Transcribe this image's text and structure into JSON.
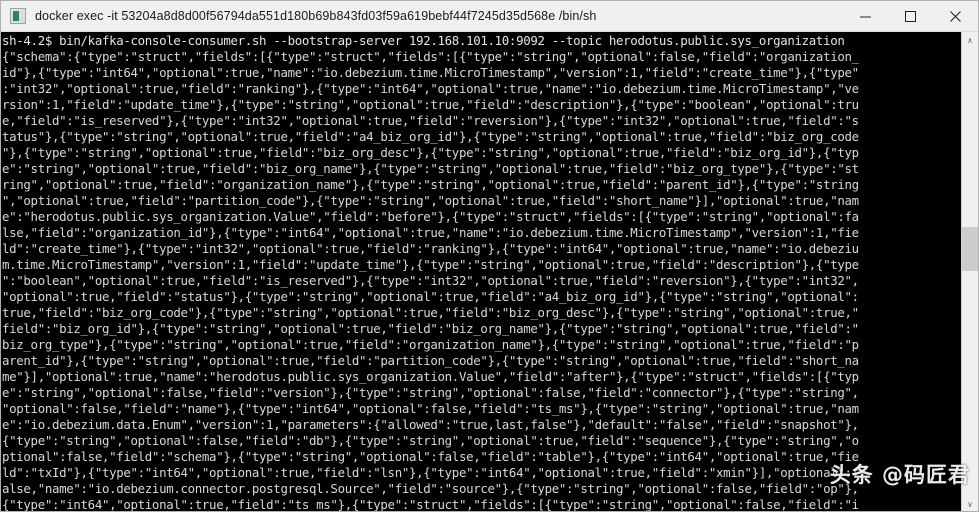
{
  "window": {
    "title": "docker  exec -it 53204a8d8d00f56794da551d180b69b843fd03f59a619bebf44f7245d35d568e /bin/sh",
    "icon": "terminal-icon",
    "minimize_label": "─",
    "maximize_label": "☐",
    "close_label": "✕"
  },
  "scrollbar": {
    "up_arrow": "∧",
    "down_arrow": "∨"
  },
  "watermark": {
    "text": "头条 @码匠君"
  },
  "terminal": {
    "prompt": "sh-4.2$",
    "command": "bin/kafka-console-consumer.sh --bootstrap-server 192.168.101.10:9092 --topic herodotus.public.sys_organization",
    "lines": [
      "sh-4.2$ bin/kafka-console-consumer.sh --bootstrap-server 192.168.101.10:9092 --topic herodotus.public.sys_organization",
      "{\"schema\":{\"type\":\"struct\",\"fields\":[{\"type\":\"struct\",\"fields\":[{\"type\":\"string\",\"optional\":false,\"field\":\"organization_",
      "id\"},{\"type\":\"int64\",\"optional\":true,\"name\":\"io.debezium.time.MicroTimestamp\",\"version\":1,\"field\":\"create_time\"},{\"type\"",
      ":\"int32\",\"optional\":true,\"field\":\"ranking\"},{\"type\":\"int64\",\"optional\":true,\"name\":\"io.debezium.time.MicroTimestamp\",\"ve",
      "rsion\":1,\"field\":\"update_time\"},{\"type\":\"string\",\"optional\":true,\"field\":\"description\"},{\"type\":\"boolean\",\"optional\":tru",
      "e,\"field\":\"is_reserved\"},{\"type\":\"int32\",\"optional\":true,\"field\":\"reversion\"},{\"type\":\"int32\",\"optional\":true,\"field\":\"s",
      "tatus\"},{\"type\":\"string\",\"optional\":true,\"field\":\"a4_biz_org_id\"},{\"type\":\"string\",\"optional\":true,\"field\":\"biz_org_code",
      "\"},{\"type\":\"string\",\"optional\":true,\"field\":\"biz_org_desc\"},{\"type\":\"string\",\"optional\":true,\"field\":\"biz_org_id\"},{\"typ",
      "e\":\"string\",\"optional\":true,\"field\":\"biz_org_name\"},{\"type\":\"string\",\"optional\":true,\"field\":\"biz_org_type\"},{\"type\":\"st",
      "ring\",\"optional\":true,\"field\":\"organization_name\"},{\"type\":\"string\",\"optional\":true,\"field\":\"parent_id\"},{\"type\":\"string",
      "\",\"optional\":true,\"field\":\"partition_code\"},{\"type\":\"string\",\"optional\":true,\"field\":\"short_name\"}],\"optional\":true,\"nam",
      "e\":\"herodotus.public.sys_organization.Value\",\"field\":\"before\"},{\"type\":\"struct\",\"fields\":[{\"type\":\"string\",\"optional\":fa",
      "lse,\"field\":\"organization_id\"},{\"type\":\"int64\",\"optional\":true,\"name\":\"io.debezium.time.MicroTimestamp\",\"version\":1,\"fie",
      "ld\":\"create_time\"},{\"type\":\"int32\",\"optional\":true,\"field\":\"ranking\"},{\"type\":\"int64\",\"optional\":true,\"name\":\"io.debeziu",
      "m.time.MicroTimestamp\",\"version\":1,\"field\":\"update_time\"},{\"type\":\"string\",\"optional\":true,\"field\":\"description\"},{\"type",
      "\":\"boolean\",\"optional\":true,\"field\":\"is_reserved\"},{\"type\":\"int32\",\"optional\":true,\"field\":\"reversion\"},{\"type\":\"int32\",",
      "\"optional\":true,\"field\":\"status\"},{\"type\":\"string\",\"optional\":true,\"field\":\"a4_biz_org_id\"},{\"type\":\"string\",\"optional\":",
      "true,\"field\":\"biz_org_code\"},{\"type\":\"string\",\"optional\":true,\"field\":\"biz_org_desc\"},{\"type\":\"string\",\"optional\":true,\"",
      "field\":\"biz_org_id\"},{\"type\":\"string\",\"optional\":true,\"field\":\"biz_org_name\"},{\"type\":\"string\",\"optional\":true,\"field\":\"",
      "biz_org_type\"},{\"type\":\"string\",\"optional\":true,\"field\":\"organization_name\"},{\"type\":\"string\",\"optional\":true,\"field\":\"p",
      "arent_id\"},{\"type\":\"string\",\"optional\":true,\"field\":\"partition_code\"},{\"type\":\"string\",\"optional\":true,\"field\":\"short_na",
      "me\"}],\"optional\":true,\"name\":\"herodotus.public.sys_organization.Value\",\"field\":\"after\"},{\"type\":\"struct\",\"fields\":[{\"typ",
      "e\":\"string\",\"optional\":false,\"field\":\"version\"},{\"type\":\"string\",\"optional\":false,\"field\":\"connector\"},{\"type\":\"string\",",
      "\"optional\":false,\"field\":\"name\"},{\"type\":\"int64\",\"optional\":false,\"field\":\"ts_ms\"},{\"type\":\"string\",\"optional\":true,\"nam",
      "e\":\"io.debezium.data.Enum\",\"version\":1,\"parameters\":{\"allowed\":\"true,last,false\"},\"default\":\"false\",\"field\":\"snapshot\"},",
      "{\"type\":\"string\",\"optional\":false,\"field\":\"db\"},{\"type\":\"string\",\"optional\":true,\"field\":\"sequence\"},{\"type\":\"string\",\"o",
      "ptional\":false,\"field\":\"schema\"},{\"type\":\"string\",\"optional\":false,\"field\":\"table\"},{\"type\":\"int64\",\"optional\":true,\"fie",
      "ld\":\"txId\"},{\"type\":\"int64\",\"optional\":true,\"field\":\"lsn\"},{\"type\":\"int64\",\"optional\":true,\"field\":\"xmin\"}],\"optional\":f",
      "alse,\"name\":\"io.debezium.connector.postgresql.Source\",\"field\":\"source\"},{\"type\":\"string\",\"optional\":false,\"field\":\"op\"},",
      "{\"type\":\"int64\",\"optional\":true,\"field\":\"ts_ms\"},{\"type\":\"struct\",\"fields\":[{\"type\":\"string\",\"optional\":false,\"field\":\"i"
    ]
  }
}
